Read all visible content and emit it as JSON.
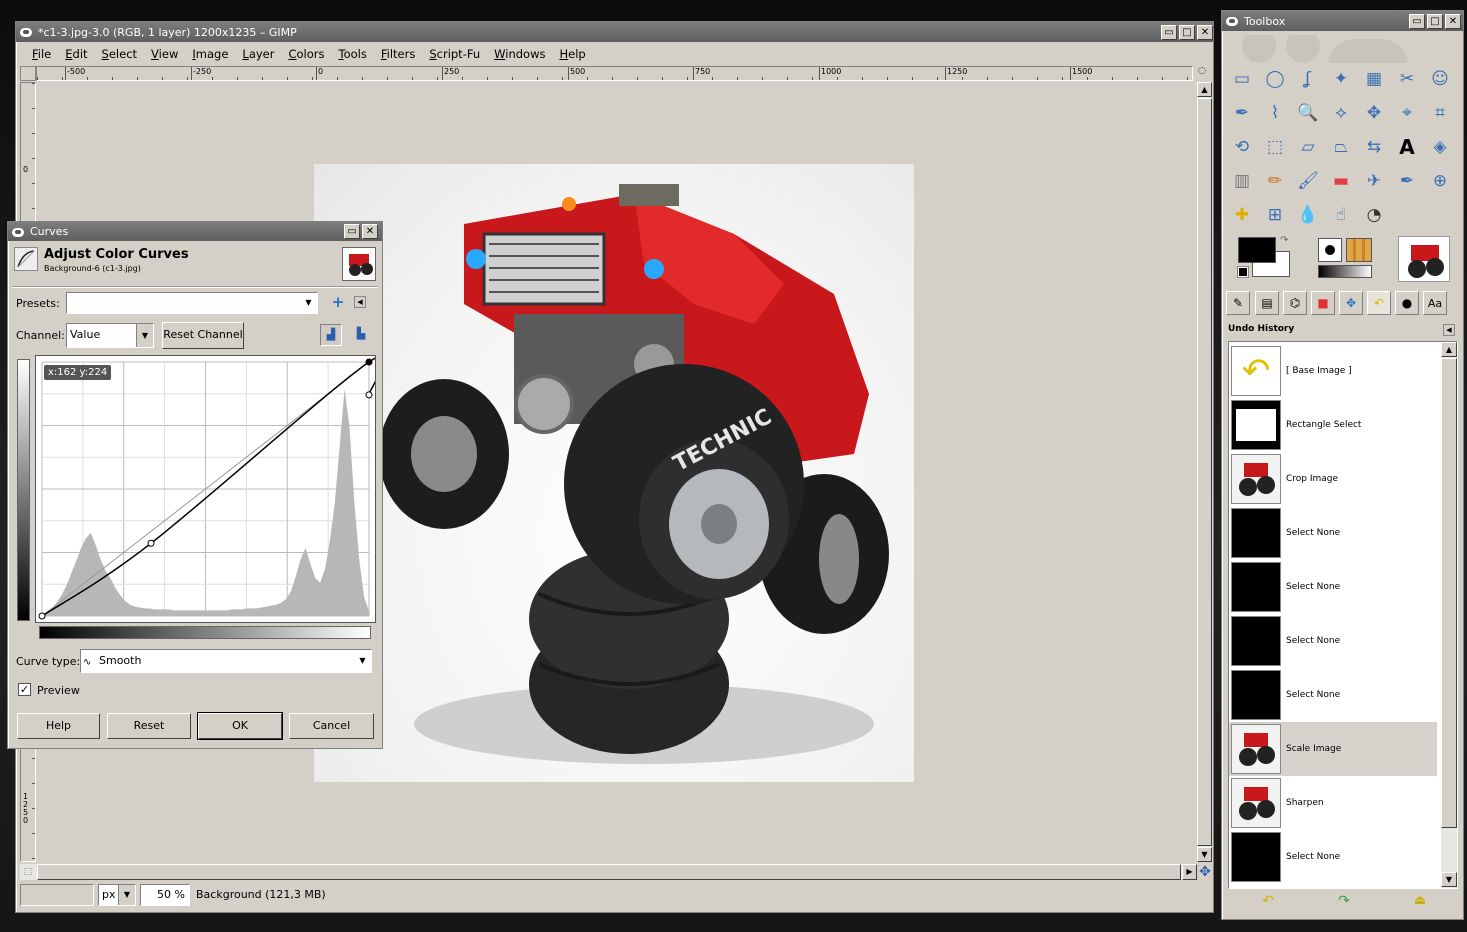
{
  "image_window": {
    "title": "*c1-3.jpg-3.0 (RGB, 1 layer) 1200x1235 – GIMP",
    "menus": [
      "File",
      "Edit",
      "Select",
      "View",
      "Image",
      "Layer",
      "Colors",
      "Tools",
      "Filters",
      "Script-Fu",
      "Windows",
      "Help"
    ],
    "ruler_h_labels": [
      "-500",
      "-250",
      "0",
      "250",
      "500",
      "750",
      "1000",
      "1250",
      "1500"
    ],
    "ruler_v_labels": [
      "0",
      "1250"
    ],
    "status": {
      "unit": "px",
      "zoom": "50 %",
      "info": "Background (121,3 MB)"
    }
  },
  "curves": {
    "window_title": "Curves",
    "header_title": "Adjust Color Curves",
    "header_subtitle": "Background-6 (c1-3.jpg)",
    "presets_label": "Presets:",
    "presets_value": "",
    "channel_label": "Channel:",
    "channel_value": "Value",
    "reset_channel": "Reset Channel",
    "cursor_readout": "x:162 y:224",
    "curve_type_label": "Curve type:",
    "curve_type_value": "Smooth",
    "preview_label": "Preview",
    "preview_checked": true,
    "buttons": {
      "help": "Help",
      "reset": "Reset",
      "ok": "OK",
      "cancel": "Cancel"
    },
    "control_points": [
      [
        0,
        0
      ],
      [
        85,
        73
      ],
      [
        270,
        222
      ],
      [
        255,
        255
      ]
    ]
  },
  "toolbox": {
    "title": "Toolbox",
    "foreground_color": "#000000",
    "background_color": "#ffffff",
    "undo_history_title": "Undo History",
    "history": [
      {
        "label": "[ Base Image ]",
        "thumb": "undo-arrow"
      },
      {
        "label": "Rectangle Select",
        "thumb": "mask"
      },
      {
        "label": "Crop Image",
        "thumb": "photo"
      },
      {
        "label": "Select None",
        "thumb": "black"
      },
      {
        "label": "Select None",
        "thumb": "black"
      },
      {
        "label": "Select None",
        "thumb": "black"
      },
      {
        "label": "Select None",
        "thumb": "black"
      },
      {
        "label": "Scale Image",
        "thumb": "photo",
        "selected": true
      },
      {
        "label": "Sharpen",
        "thumb": "photo"
      },
      {
        "label": "Select None",
        "thumb": "black"
      }
    ],
    "tools": [
      "rect-select",
      "ellipse-select",
      "free-select",
      "fuzzy-select",
      "color-select",
      "scissors",
      "foreground-select",
      "paths",
      "color-picker",
      "zoom",
      "measure",
      "move",
      "align",
      "crop",
      "rotate",
      "scale",
      "shear",
      "perspective",
      "flip",
      "text",
      "bucket-fill",
      "blend",
      "pencil",
      "paintbrush",
      "eraser",
      "airbrush",
      "ink",
      "clone",
      "heal",
      "perspective-clone",
      "blur",
      "smudge",
      "dodge-burn"
    ]
  }
}
